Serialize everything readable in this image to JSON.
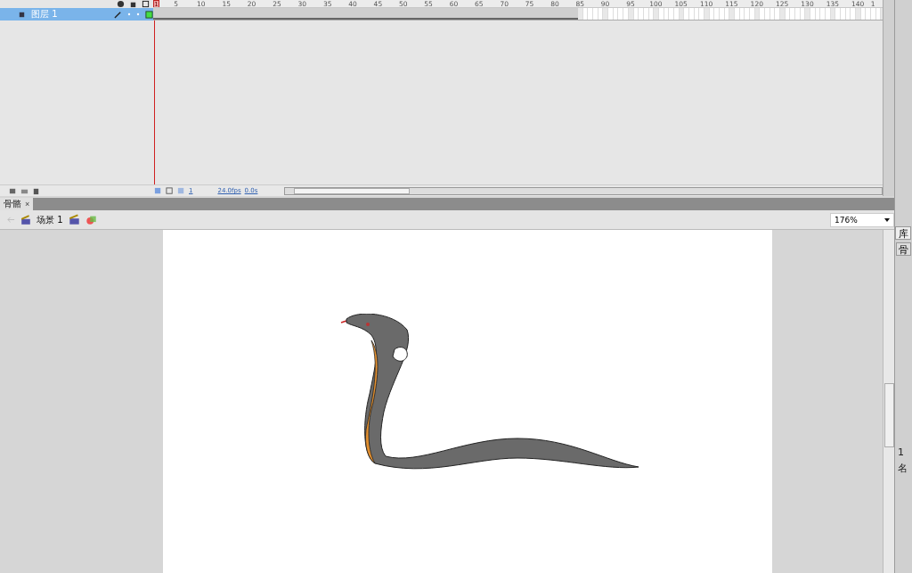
{
  "timeline": {
    "ruler": {
      "current": "1",
      "ticks": [
        "5",
        "10",
        "15",
        "20",
        "25",
        "30",
        "35",
        "40",
        "45",
        "50",
        "55",
        "60",
        "65",
        "70",
        "75",
        "80",
        "85",
        "90",
        "95",
        "100",
        "105",
        "110",
        "115",
        "120",
        "125",
        "130",
        "135",
        "140"
      ],
      "cut_tick": "1"
    },
    "layers": [
      {
        "name": "图层 1",
        "selected": true
      }
    ],
    "toolbar": {
      "current_frame": "1",
      "frame_rate": "24.0fps",
      "elapsed": "0.0s"
    }
  },
  "document_tabs": [
    {
      "label": "骨骼",
      "selected": true,
      "close": "×"
    }
  ],
  "edit_bar": {
    "scene": "场景 1",
    "zoom": "176%"
  },
  "side_panel": {
    "tab": "库",
    "button": "骨",
    "count": "1",
    "column": "名"
  }
}
